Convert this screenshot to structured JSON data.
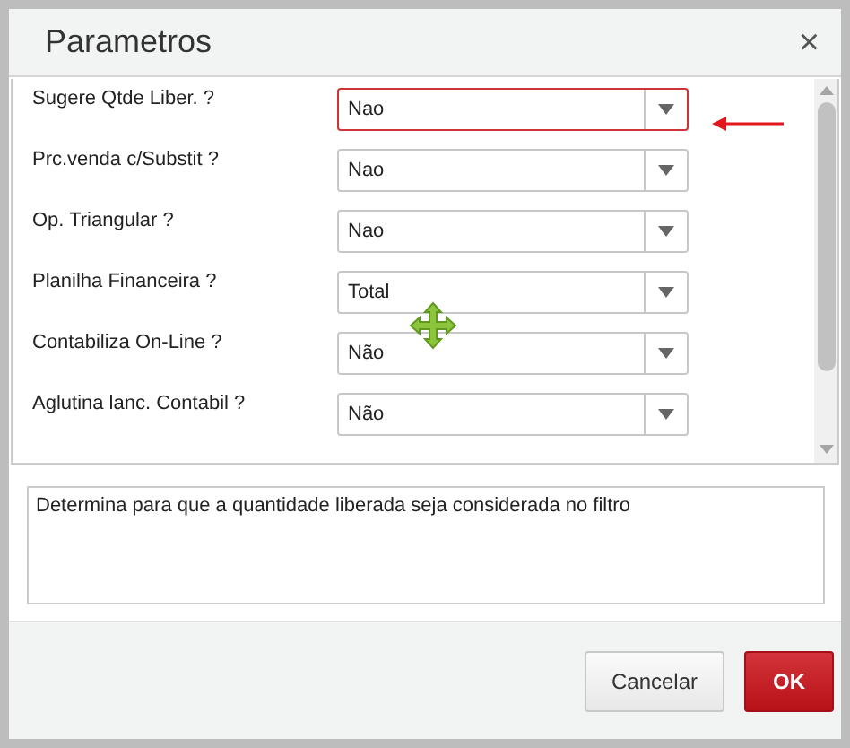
{
  "dialog": {
    "title": "Parametros",
    "close": "×"
  },
  "params": [
    {
      "label": "Sugere Qtde Liber. ?",
      "value": "Nao",
      "focused": true
    },
    {
      "label": "Prc.venda c/Substit ?",
      "value": "Nao",
      "focused": false
    },
    {
      "label": "Op. Triangular ?",
      "value": "Nao",
      "focused": false
    },
    {
      "label": "Planilha Financeira ?",
      "value": "Total",
      "focused": false
    },
    {
      "label": "Contabiliza On-Line ?",
      "value": "Não",
      "focused": false
    },
    {
      "label": "Aglutina lanc. Contabil ?",
      "value": "Não",
      "focused": false
    }
  ],
  "description": "Determina para que a quantidade liberada seja considerada no filtro",
  "buttons": [
    {
      "label": "Cancelar",
      "kind": "secondary"
    },
    {
      "label": "OK",
      "kind": "primary"
    }
  ]
}
